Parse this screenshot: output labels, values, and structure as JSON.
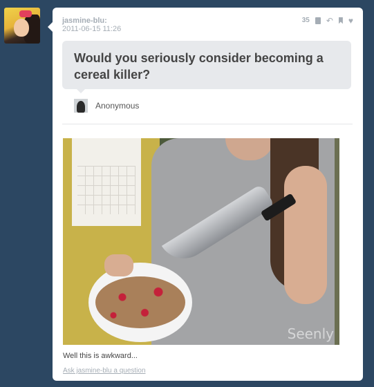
{
  "blog": {
    "username": "jasmine-blu:",
    "timestamp": "2011-06-15 11:26"
  },
  "controls": {
    "note_count": "35",
    "icons": [
      "notes-icon",
      "reblog-icon",
      "bookmark-icon",
      "like-icon"
    ]
  },
  "question": {
    "text": "Would you seriously consider becoming a cereal killer?",
    "asker": "Anonymous"
  },
  "photo": {
    "watermark": "Seenly"
  },
  "answer": {
    "caption": "Well this is awkward...",
    "ask_link": "Ask jasmine-blu a question"
  },
  "colors": {
    "background": "#2c4762",
    "card": "#ffffff",
    "question_bubble": "#e7e9ec",
    "meta_text": "#a5adb5"
  }
}
